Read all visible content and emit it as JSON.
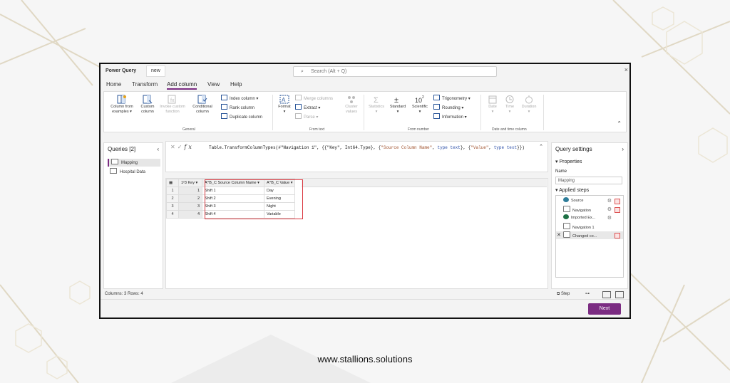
{
  "window": {
    "app_title": "Power Query",
    "file_name": "new",
    "search_placeholder": "Search (Alt + Q)",
    "close": "×"
  },
  "menu": {
    "tabs": [
      "Home",
      "Transform",
      "Add column",
      "View",
      "Help"
    ],
    "active": "Add column"
  },
  "ribbon": {
    "general": {
      "group_label": "General",
      "column_from_examples": "Column from examples",
      "custom_column": "Custom column",
      "invoke_custom_function": "Invoke custom function",
      "conditional_column": "Conditional column",
      "index_column": "Index column",
      "rank_column": "Rank column",
      "duplicate_column": "Duplicate column"
    },
    "from_text": {
      "group_label": "From text",
      "format": "Format",
      "merge_columns": "Merge columns",
      "extract": "Extract",
      "parse": "Parse",
      "cluster_values": "Cluster values"
    },
    "from_number": {
      "group_label": "From number",
      "statistics": "Statistics",
      "standard": "Standard",
      "scientific": "Scientific",
      "trigonometry": "Trigonometry",
      "rounding": "Rounding",
      "information": "Information"
    },
    "date_time": {
      "group_label": "Date and time column",
      "date": "Date",
      "time": "Time",
      "duration": "Duration"
    }
  },
  "queries": {
    "title": "Queries [2]",
    "items": [
      "Mapping",
      "Hospital Data"
    ],
    "selected": "Mapping"
  },
  "formula": {
    "fx": "fx",
    "p1": "Table.TransformColumnTypes(#\"Navigation 1\", {{\"Key\", Int64.Type}, {",
    "s1": "\"Source Column Name\"",
    "p2": ", ",
    "k1": "type text",
    "p3": "}, {",
    "s2": "\"Value\"",
    "p4": ", ",
    "k2": "type text",
    "p5": "}})"
  },
  "grid": {
    "columns": [
      "Key",
      "Source Column Name",
      "Value"
    ],
    "column_type_icons": [
      "1²3",
      "A^B_C",
      "A^B_C"
    ],
    "rows": [
      {
        "n": "1",
        "key": "1",
        "src": "Shift 1",
        "val": "Day"
      },
      {
        "n": "2",
        "key": "2",
        "src": "Shift 2",
        "val": "Evening"
      },
      {
        "n": "3",
        "key": "3",
        "src": "Shift 3",
        "val": "Night"
      },
      {
        "n": "4",
        "key": "4",
        "src": "Shift 4",
        "val": "Variable"
      }
    ],
    "highlight_color": "#d9363e"
  },
  "status": {
    "summary": "Columns: 3   Rows: 4",
    "step_label": "Step"
  },
  "settings": {
    "title": "Query settings",
    "properties": "Properties",
    "name_label": "Name",
    "name_value": "Mapping",
    "applied_steps": "Applied steps",
    "steps": [
      "Source",
      "Navigation",
      "Imported Ex...",
      "Navigation 1",
      "Changed co..."
    ]
  },
  "footer": {
    "next": "Next"
  },
  "site": "www.stallions.solutions",
  "colors": {
    "accent": "#7b2c82",
    "excel_green": "#1e7145"
  }
}
